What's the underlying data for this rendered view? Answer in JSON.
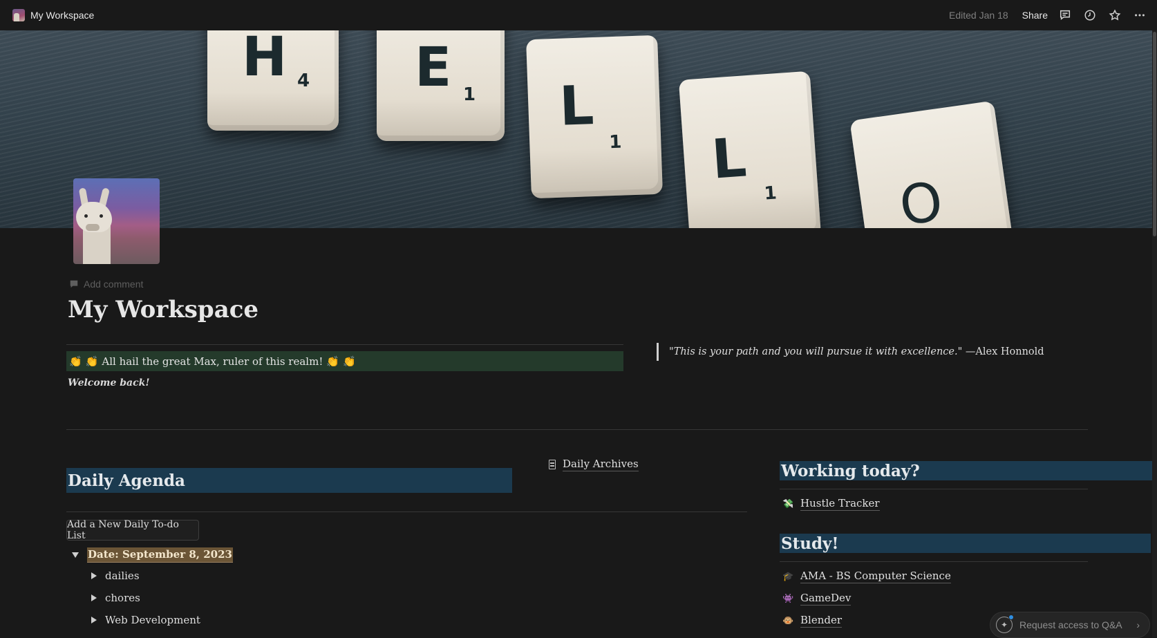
{
  "topbar": {
    "workspace_name": "My Workspace",
    "edited": "Edited Jan 18",
    "share_label": "Share"
  },
  "cover": {
    "tiles": [
      {
        "letter": "H",
        "num": "4"
      },
      {
        "letter": "E",
        "num": "1"
      },
      {
        "letter": "L",
        "num": "1"
      },
      {
        "letter": "L",
        "num": "1"
      },
      {
        "letter": "O",
        "num": ""
      }
    ]
  },
  "page": {
    "add_comment": "Add comment",
    "title": "My Workspace",
    "hail_message": "All hail the great Max, ruler of this realm!",
    "clap_emoji": "👏",
    "welcome": "Welcome back!",
    "quote_open": "\"",
    "quote_text": "This is your path and you will pursue it with excellence.",
    "quote_close": "\" —Alex Honnold"
  },
  "agenda": {
    "heading": "Daily Agenda",
    "archives_label": "Daily Archives",
    "new_list_button": "Add a New Daily To-do List",
    "date_toggle": "Date: September 8, 2023",
    "sub_toggles": [
      "dailies",
      "chores",
      "Web Development"
    ]
  },
  "working": {
    "heading": "Working today?",
    "links": [
      {
        "icon": "💸",
        "label": "Hustle Tracker"
      }
    ]
  },
  "study": {
    "heading": "Study!",
    "links": [
      {
        "icon": "🎓",
        "label": "AMA - BS Computer Science"
      },
      {
        "icon": "👾",
        "label": "GameDev"
      },
      {
        "icon": "🐵",
        "label": "Blender"
      }
    ]
  },
  "qa": {
    "label": "Request access to Q&A"
  },
  "icons": {
    "comments": "comment-icon",
    "history": "clock-icon",
    "favorite": "star-icon",
    "more": "more-dots-icon"
  },
  "colors": {
    "background": "#191919",
    "heading_band": "#1b3a4f",
    "green_banner": "#243a2b",
    "date_highlight": "#6b5536"
  }
}
